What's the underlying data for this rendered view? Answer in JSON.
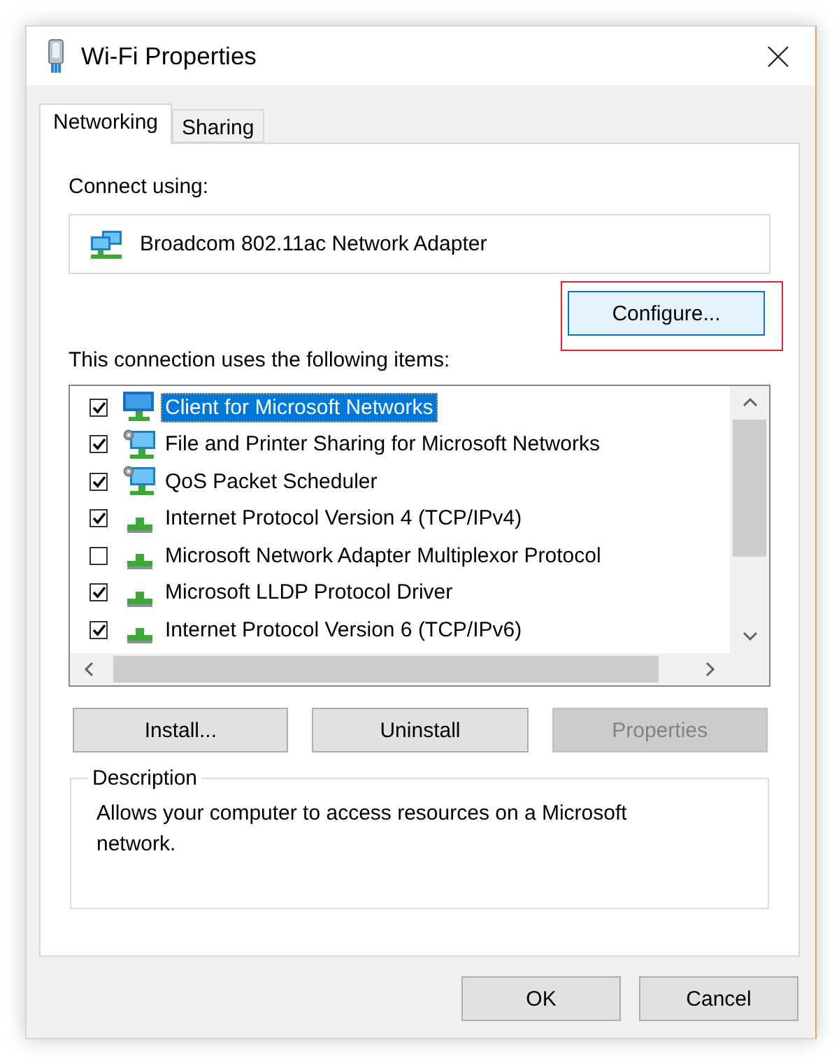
{
  "window": {
    "title": "Wi-Fi Properties"
  },
  "tabs": [
    {
      "label": "Networking",
      "selected": true
    },
    {
      "label": "Sharing",
      "selected": false
    }
  ],
  "connect_using": {
    "label": "Connect using:",
    "adapter": "Broadcom 802.11ac Network Adapter"
  },
  "configure_button": {
    "label": "Configure...",
    "focused": true,
    "highlighted": true
  },
  "items": {
    "label": "This connection uses the following items:",
    "rows": [
      {
        "name": "Client for Microsoft Networks",
        "kind": "client",
        "checked": true,
        "selected": true
      },
      {
        "name": "File and Printer Sharing for Microsoft Networks",
        "kind": "service",
        "checked": true,
        "selected": false
      },
      {
        "name": "QoS Packet Scheduler",
        "kind": "service",
        "checked": true,
        "selected": false
      },
      {
        "name": "Internet Protocol Version 4 (TCP/IPv4)",
        "kind": "protocol",
        "checked": true,
        "selected": false
      },
      {
        "name": "Microsoft Network Adapter Multiplexor Protocol",
        "kind": "protocol",
        "checked": false,
        "selected": false
      },
      {
        "name": "Microsoft LLDP Protocol Driver",
        "kind": "protocol",
        "checked": true,
        "selected": false
      },
      {
        "name": "Internet Protocol Version 6 (TCP/IPv6)",
        "kind": "protocol",
        "checked": true,
        "selected": false
      }
    ]
  },
  "item_buttons": [
    {
      "label": "Install...",
      "disabled": false
    },
    {
      "label": "Uninstall",
      "disabled": false
    },
    {
      "label": "Properties",
      "disabled": true
    }
  ],
  "description": {
    "title": "Description",
    "text": "Allows your computer to access resources on a Microsoft network."
  },
  "buttons": [
    "OK",
    "Cancel"
  ]
}
